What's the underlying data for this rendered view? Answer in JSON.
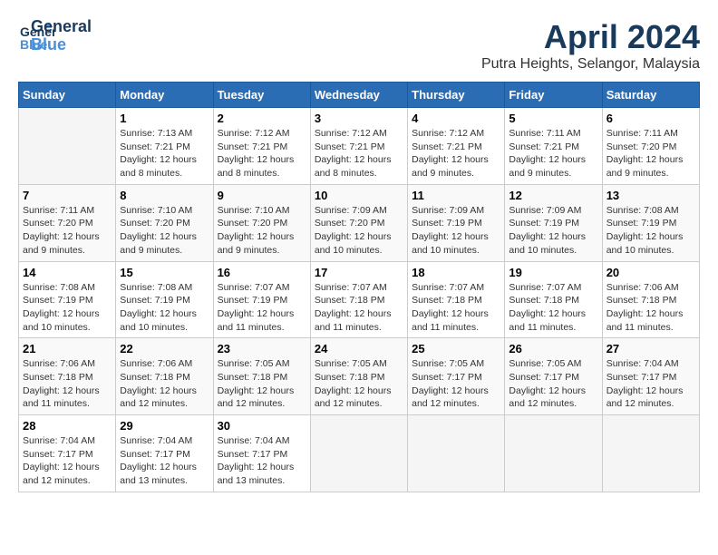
{
  "header": {
    "logo_general": "General",
    "logo_blue": "Blue",
    "title": "April 2024",
    "subtitle": "Putra Heights, Selangor, Malaysia"
  },
  "calendar": {
    "days_of_week": [
      "Sunday",
      "Monday",
      "Tuesday",
      "Wednesday",
      "Thursday",
      "Friday",
      "Saturday"
    ],
    "weeks": [
      [
        {
          "day": "",
          "info": ""
        },
        {
          "day": "1",
          "info": "Sunrise: 7:13 AM\nSunset: 7:21 PM\nDaylight: 12 hours\nand 8 minutes."
        },
        {
          "day": "2",
          "info": "Sunrise: 7:12 AM\nSunset: 7:21 PM\nDaylight: 12 hours\nand 8 minutes."
        },
        {
          "day": "3",
          "info": "Sunrise: 7:12 AM\nSunset: 7:21 PM\nDaylight: 12 hours\nand 8 minutes."
        },
        {
          "day": "4",
          "info": "Sunrise: 7:12 AM\nSunset: 7:21 PM\nDaylight: 12 hours\nand 9 minutes."
        },
        {
          "day": "5",
          "info": "Sunrise: 7:11 AM\nSunset: 7:21 PM\nDaylight: 12 hours\nand 9 minutes."
        },
        {
          "day": "6",
          "info": "Sunrise: 7:11 AM\nSunset: 7:20 PM\nDaylight: 12 hours\nand 9 minutes."
        }
      ],
      [
        {
          "day": "7",
          "info": "Sunrise: 7:11 AM\nSunset: 7:20 PM\nDaylight: 12 hours\nand 9 minutes."
        },
        {
          "day": "8",
          "info": "Sunrise: 7:10 AM\nSunset: 7:20 PM\nDaylight: 12 hours\nand 9 minutes."
        },
        {
          "day": "9",
          "info": "Sunrise: 7:10 AM\nSunset: 7:20 PM\nDaylight: 12 hours\nand 9 minutes."
        },
        {
          "day": "10",
          "info": "Sunrise: 7:09 AM\nSunset: 7:20 PM\nDaylight: 12 hours\nand 10 minutes."
        },
        {
          "day": "11",
          "info": "Sunrise: 7:09 AM\nSunset: 7:19 PM\nDaylight: 12 hours\nand 10 minutes."
        },
        {
          "day": "12",
          "info": "Sunrise: 7:09 AM\nSunset: 7:19 PM\nDaylight: 12 hours\nand 10 minutes."
        },
        {
          "day": "13",
          "info": "Sunrise: 7:08 AM\nSunset: 7:19 PM\nDaylight: 12 hours\nand 10 minutes."
        }
      ],
      [
        {
          "day": "14",
          "info": "Sunrise: 7:08 AM\nSunset: 7:19 PM\nDaylight: 12 hours\nand 10 minutes."
        },
        {
          "day": "15",
          "info": "Sunrise: 7:08 AM\nSunset: 7:19 PM\nDaylight: 12 hours\nand 10 minutes."
        },
        {
          "day": "16",
          "info": "Sunrise: 7:07 AM\nSunset: 7:19 PM\nDaylight: 12 hours\nand 11 minutes."
        },
        {
          "day": "17",
          "info": "Sunrise: 7:07 AM\nSunset: 7:18 PM\nDaylight: 12 hours\nand 11 minutes."
        },
        {
          "day": "18",
          "info": "Sunrise: 7:07 AM\nSunset: 7:18 PM\nDaylight: 12 hours\nand 11 minutes."
        },
        {
          "day": "19",
          "info": "Sunrise: 7:07 AM\nSunset: 7:18 PM\nDaylight: 12 hours\nand 11 minutes."
        },
        {
          "day": "20",
          "info": "Sunrise: 7:06 AM\nSunset: 7:18 PM\nDaylight: 12 hours\nand 11 minutes."
        }
      ],
      [
        {
          "day": "21",
          "info": "Sunrise: 7:06 AM\nSunset: 7:18 PM\nDaylight: 12 hours\nand 11 minutes."
        },
        {
          "day": "22",
          "info": "Sunrise: 7:06 AM\nSunset: 7:18 PM\nDaylight: 12 hours\nand 12 minutes."
        },
        {
          "day": "23",
          "info": "Sunrise: 7:05 AM\nSunset: 7:18 PM\nDaylight: 12 hours\nand 12 minutes."
        },
        {
          "day": "24",
          "info": "Sunrise: 7:05 AM\nSunset: 7:18 PM\nDaylight: 12 hours\nand 12 minutes."
        },
        {
          "day": "25",
          "info": "Sunrise: 7:05 AM\nSunset: 7:17 PM\nDaylight: 12 hours\nand 12 minutes."
        },
        {
          "day": "26",
          "info": "Sunrise: 7:05 AM\nSunset: 7:17 PM\nDaylight: 12 hours\nand 12 minutes."
        },
        {
          "day": "27",
          "info": "Sunrise: 7:04 AM\nSunset: 7:17 PM\nDaylight: 12 hours\nand 12 minutes."
        }
      ],
      [
        {
          "day": "28",
          "info": "Sunrise: 7:04 AM\nSunset: 7:17 PM\nDaylight: 12 hours\nand 12 minutes."
        },
        {
          "day": "29",
          "info": "Sunrise: 7:04 AM\nSunset: 7:17 PM\nDaylight: 12 hours\nand 13 minutes."
        },
        {
          "day": "30",
          "info": "Sunrise: 7:04 AM\nSunset: 7:17 PM\nDaylight: 12 hours\nand 13 minutes."
        },
        {
          "day": "",
          "info": ""
        },
        {
          "day": "",
          "info": ""
        },
        {
          "day": "",
          "info": ""
        },
        {
          "day": "",
          "info": ""
        }
      ]
    ]
  }
}
